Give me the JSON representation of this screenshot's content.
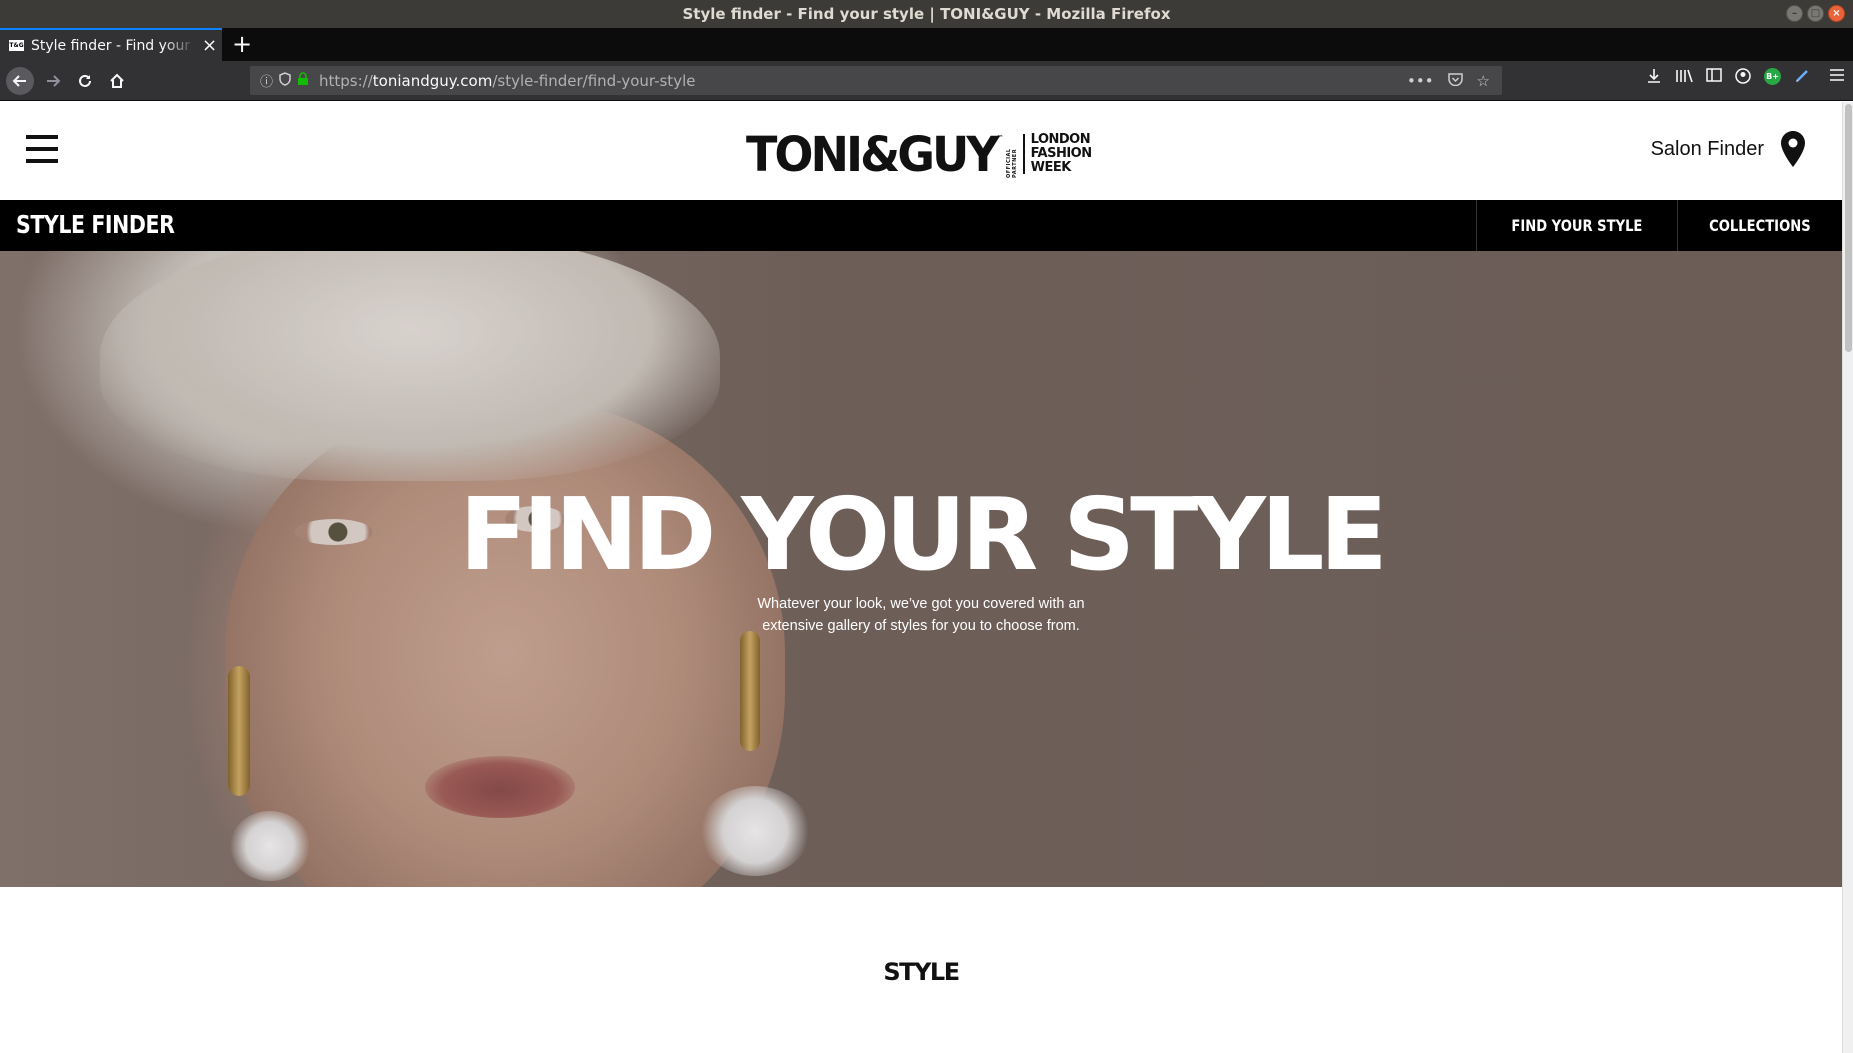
{
  "window": {
    "title": "Style finder - Find your style | TONI&GUY - Mozilla Firefox"
  },
  "browser": {
    "tab": {
      "favicon_text": "T&G",
      "title": "Style finder - Find your style | TONI&GUY"
    },
    "url": {
      "scheme": "https://",
      "host": "toniandguy.com",
      "path": "/style-finder/find-your-style"
    },
    "extension_badge": "B+"
  },
  "site": {
    "logo": {
      "wordmark": "TONI&GUY",
      "tm": "™",
      "partner_text": "OFFICIAL PARTNER",
      "lfw_lines": [
        "LONDON",
        "FASHION",
        "WEEK"
      ]
    },
    "salon_finder_label": "Salon Finder",
    "subnav": {
      "title": "STYLE FINDER",
      "links": [
        "FIND YOUR STYLE",
        "COLLECTIONS"
      ]
    },
    "hero": {
      "heading": "FIND YOUR STYLE",
      "subtitle_line1": "Whatever your look, we’ve got you covered with an",
      "subtitle_line2": "extensive gallery of styles for you to choose from."
    },
    "section_title": "STYLE"
  },
  "colors": {
    "header_bg": "#ffffff",
    "subnav_bg": "#000000",
    "hero_bg": "#75665f",
    "accent_tab": "#0a84ff"
  }
}
